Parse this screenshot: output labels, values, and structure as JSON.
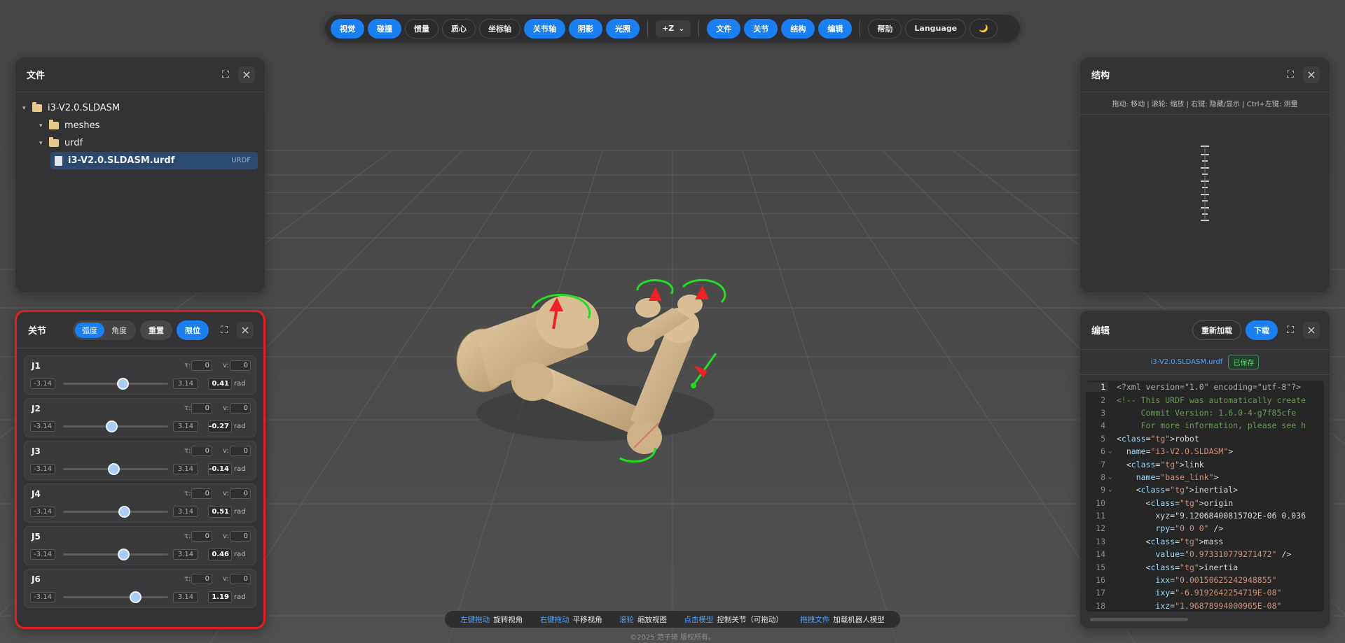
{
  "toolbar": {
    "view_buttons": [
      {
        "label": "视觉",
        "active": true
      },
      {
        "label": "碰撞",
        "active": true
      },
      {
        "label": "惯量",
        "active": false
      },
      {
        "label": "质心",
        "active": false
      },
      {
        "label": "坐标轴",
        "active": false
      },
      {
        "label": "关节轴",
        "active": true
      },
      {
        "label": "阴影",
        "active": true
      },
      {
        "label": "光照",
        "active": true
      }
    ],
    "up_axis": "+Z",
    "panel_buttons": [
      {
        "label": "文件",
        "active": true
      },
      {
        "label": "关节",
        "active": true
      },
      {
        "label": "结构",
        "active": true
      },
      {
        "label": "编辑",
        "active": true
      }
    ],
    "help": "帮助",
    "language": "Language",
    "theme_icon": "🌙"
  },
  "files_panel": {
    "title": "文件",
    "tree": [
      {
        "name": "i3-V2.0.SLDASM",
        "type": "folder",
        "depth": 0
      },
      {
        "name": "meshes",
        "type": "folder",
        "depth": 1
      },
      {
        "name": "urdf",
        "type": "folder",
        "depth": 1
      },
      {
        "name": "i3-V2.0.SLDASM.urdf",
        "type": "file",
        "depth": 2,
        "tag": "URDF",
        "selected": true
      }
    ]
  },
  "joints_panel": {
    "title": "关节",
    "mode_radian": "弧度",
    "mode_degree": "角度",
    "reset": "重置",
    "limits": "限位",
    "tau_label": "τ:",
    "v_label": "v:",
    "unit": "rad",
    "joints": [
      {
        "name": "J1",
        "min": "-3.14",
        "max": "3.14",
        "value": "0.41",
        "value_num": 0.41,
        "tau": "0",
        "v": "0"
      },
      {
        "name": "J2",
        "min": "-3.14",
        "max": "3.14",
        "value": "-0.27",
        "value_num": -0.27,
        "tau": "0",
        "v": "0"
      },
      {
        "name": "J3",
        "min": "-3.14",
        "max": "3.14",
        "value": "-0.14",
        "value_num": -0.14,
        "tau": "0",
        "v": "0"
      },
      {
        "name": "J4",
        "min": "-3.14",
        "max": "3.14",
        "value": "0.51",
        "value_num": 0.51,
        "tau": "0",
        "v": "0"
      },
      {
        "name": "J5",
        "min": "-3.14",
        "max": "3.14",
        "value": "0.46",
        "value_num": 0.46,
        "tau": "0",
        "v": "0"
      },
      {
        "name": "J6",
        "min": "-3.14",
        "max": "3.14",
        "value": "1.19",
        "value_num": 1.19,
        "tau": "0",
        "v": "0"
      }
    ]
  },
  "structure_panel": {
    "title": "结构",
    "hint": "拖动: 移动 | 滚轮: 缩放 | 右键: 隐藏/显示 | Ctrl+左键: 测量"
  },
  "editor_panel": {
    "title": "编辑",
    "reload": "重新加载",
    "download": "下载",
    "filename": "i3-V2.0.SLDASM.urdf",
    "saved": "已保存",
    "lines": [
      "<?xml version=\"1.0\" encoding=\"utf-8\"?>",
      "<!-- This URDF was automatically create",
      "     Commit Version: 1.6.0-4-g7f85cfe",
      "     For more information, please see h",
      "<robot",
      "  name=\"i3-V2.0.SLDASM\">",
      "  <link",
      "    name=\"base_link\">",
      "    <inertial>",
      "      <origin",
      "        xyz=\"9.12068400815702E-06 0.036",
      "        rpy=\"0 0 0\" />",
      "      <mass",
      "        value=\"0.973310779271472\" />",
      "      <inertia",
      "        ixx=\"0.00150625242948855\"",
      "        ixy=\"-6.9192642254719E-08\"",
      "        ixz=\"1.96878994000965E-08\""
    ]
  },
  "helpbar": [
    {
      "key": "左键拖动",
      "desc": "旋转视角"
    },
    {
      "key": "右键拖动",
      "desc": "平移视角"
    },
    {
      "key": "滚轮",
      "desc": "缩放视图"
    },
    {
      "key": "点击模型",
      "desc": "控制关节（可拖动）"
    },
    {
      "key": "拖拽文件",
      "desc": "加载机器人模型"
    }
  ],
  "copyright": "©2025 范子琦 版权所有。",
  "colors": {
    "accent": "#1a7ff0",
    "highlight_border": "#e02020"
  }
}
